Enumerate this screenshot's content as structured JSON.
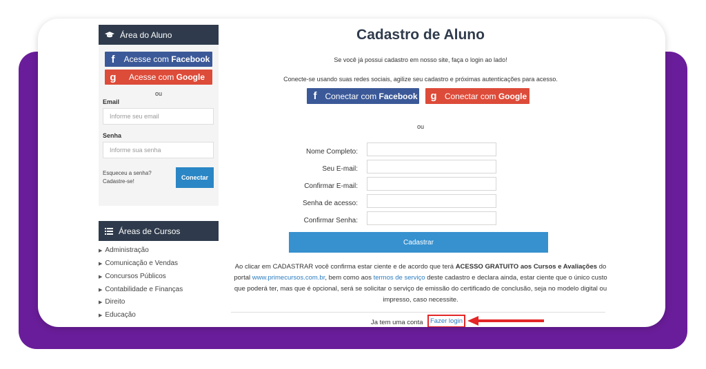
{
  "sidebar": {
    "area_aluno": {
      "title": "Área do Aluno",
      "facebook_prefix": "Acesse com ",
      "facebook_brand": "Facebook",
      "google_prefix": "Acesse com ",
      "google_brand": "Google",
      "ou": "ou",
      "email_label": "Email",
      "email_placeholder": "Informe seu email",
      "senha_label": "Senha",
      "senha_placeholder": "Informe sua senha",
      "esqueceu": "Esqueceu a senha?",
      "cadastre": "Cadastre-se!",
      "conectar": "Conectar"
    },
    "areas_cursos": {
      "title": "Áreas de Cursos",
      "items": [
        "Administração",
        "Comunicação e Vendas",
        "Concursos Públicos",
        "Contabilidade e Finanças",
        "Direito",
        "Educação"
      ]
    }
  },
  "main": {
    "title": "Cadastro de Aluno",
    "login_hint": "Se você já possui cadastro em nosso site, faça o login ao lado!",
    "social_hint": "Conecte-se usando suas redes sociais, agilize seu cadastro e próximas autenticações para acesso.",
    "fb_prefix": "Conectar com ",
    "fb_brand": "Facebook",
    "gg_prefix": "Conectar com ",
    "gg_brand": "Google",
    "ou": "ou",
    "form": {
      "nome": "Nome Completo:",
      "email": "Seu E-mail:",
      "confirmar_email": "Confirmar E-mail:",
      "senha": "Senha de acesso:",
      "confirmar_senha": "Confirmar Senha:"
    },
    "cadastrar": "Cadastrar",
    "terms": {
      "p1": "Ao clicar em CADASTRAR você confirma estar ciente e de acordo que terá ",
      "bold": "ACESSO GRATUITO aos Cursos e Avaliações",
      "p2": " do portal ",
      "site": "www.primecursos.com.br",
      "p3": ", bem como aos ",
      "tos": "termos de serviço",
      "p4": " deste cadastro e declara ainda, estar ciente que o único custo que poderá ter, mas que é opcional, será se solicitar o serviço de emissão do certificado de conclusão, seja no modelo digital ou impresso, caso necessite."
    },
    "ja_tem_conta": "Ja tem uma conta",
    "fazer_login": "Fazer login"
  },
  "colors": {
    "purple_bg": "#6a1d9a",
    "panel_head": "#2f3b4c",
    "facebook": "#3b5998",
    "google": "#dd4b39",
    "primary_button": "#3791cf",
    "highlight_red": "#e32626"
  },
  "icons": {
    "area_aluno": "graduation-cap-icon",
    "areas_cursos": "list-icon",
    "facebook": "facebook-icon",
    "google": "google-icon",
    "list_bullet": "caret-right-icon",
    "annotation": "red-arrow-icon"
  }
}
